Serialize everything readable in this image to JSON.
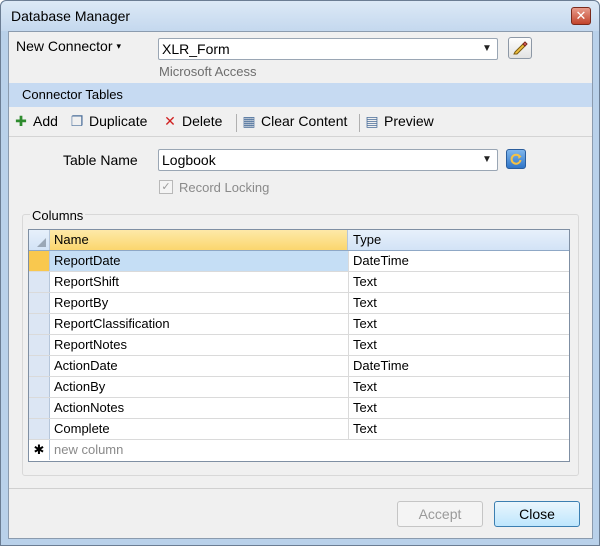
{
  "window": {
    "title": "Database Manager",
    "close_glyph": "✕"
  },
  "connector": {
    "new_label": "New Connector",
    "caret": "▾",
    "selected": "XLR_Form",
    "subtitle": "Microsoft Access",
    "edit_icon": "pencil-icon"
  },
  "section": {
    "title": "Connector Tables"
  },
  "toolbar": {
    "add": "Add",
    "duplicate": "Duplicate",
    "delete": "Delete",
    "clear": "Clear Content",
    "preview": "Preview"
  },
  "table": {
    "label": "Table Name",
    "selected": "Logbook",
    "refresh_icon": "refresh-icon",
    "record_locking": "Record Locking",
    "record_locking_checked": true
  },
  "columns": {
    "group_title": "Columns",
    "headers": {
      "name": "Name",
      "type": "Type"
    },
    "rows": [
      {
        "name": "ReportDate",
        "type": "DateTime"
      },
      {
        "name": "ReportShift",
        "type": "Text"
      },
      {
        "name": "ReportBy",
        "type": "Text"
      },
      {
        "name": "ReportClassification",
        "type": "Text"
      },
      {
        "name": "ReportNotes",
        "type": "Text"
      },
      {
        "name": "ActionDate",
        "type": "DateTime"
      },
      {
        "name": "ActionBy",
        "type": "Text"
      },
      {
        "name": "ActionNotes",
        "type": "Text"
      },
      {
        "name": "Complete",
        "type": "Text"
      }
    ],
    "new_row_marker": "✱",
    "new_row_placeholder": "new column"
  },
  "buttons": {
    "accept": "Accept",
    "close": "Close"
  },
  "colors": {
    "selected_row_header": "#f9c84e",
    "selected_cell": "#c5def5",
    "section_header": "#c6daf2"
  }
}
